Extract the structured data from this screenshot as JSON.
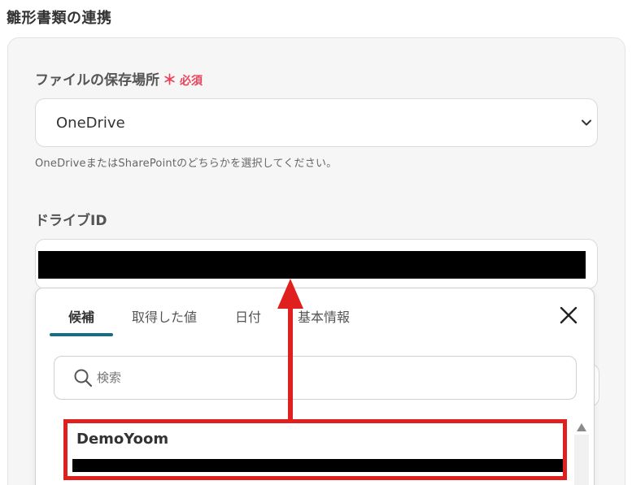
{
  "section": {
    "title": "雛形書類の連携"
  },
  "storage": {
    "label": "ファイルの保存場所",
    "required_mark": "＊",
    "required_text": "必須",
    "selected": "OneDrive",
    "help": "OneDriveまたはSharePointのどちらかを選択してください。"
  },
  "drive": {
    "label": "ドライブID"
  },
  "popup": {
    "tabs": [
      {
        "label": "候補"
      },
      {
        "label": "取得した値"
      },
      {
        "label": "日付"
      },
      {
        "label": "基本情報"
      }
    ],
    "search_placeholder": "検索",
    "options": [
      {
        "title": "DemoYoom"
      }
    ]
  },
  "icons": {
    "close": "close-icon",
    "search": "search-icon",
    "chevron": "chevron-down-icon",
    "scroll": "triangle-up-icon"
  },
  "colors": {
    "accent": "#1a6d80",
    "required": "#e8435b",
    "annotation": "#e0201e"
  }
}
